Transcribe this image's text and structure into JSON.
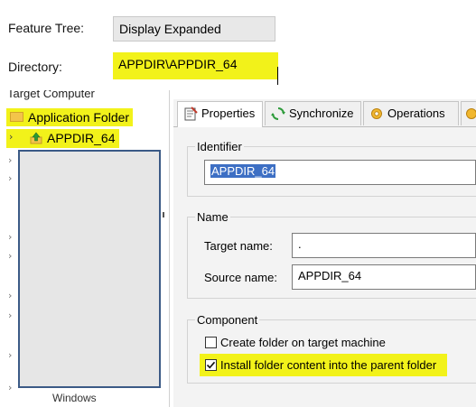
{
  "feature_tree": {
    "label": "Feature Tree:",
    "value": "Display Expanded"
  },
  "directory": {
    "label": "Directory:",
    "value": "APPDIR\\APPDIR_64"
  },
  "tree": {
    "root_partial": "Target Computer",
    "application_folder": "Application Folder",
    "appdir_64": "APPDIR_64",
    "bottom_partial": "Windows"
  },
  "tabs": [
    {
      "label": "Properties"
    },
    {
      "label": "Synchronize"
    },
    {
      "label": "Operations"
    }
  ],
  "identifier": {
    "legend": "Identifier",
    "value": "APPDIR_64"
  },
  "name": {
    "legend": "Name",
    "target_label": "Target name:",
    "target_value": ".",
    "source_label": "Source name:",
    "source_value": "APPDIR_64"
  },
  "component": {
    "legend": "Component",
    "create_folder": {
      "label": "Create folder on target machine",
      "checked": false
    },
    "install_parent": {
      "label": "Install folder content into the parent folder",
      "checked": true
    }
  },
  "colors": {
    "highlight": "#f2f21a",
    "selection": "#3d6fc4"
  }
}
